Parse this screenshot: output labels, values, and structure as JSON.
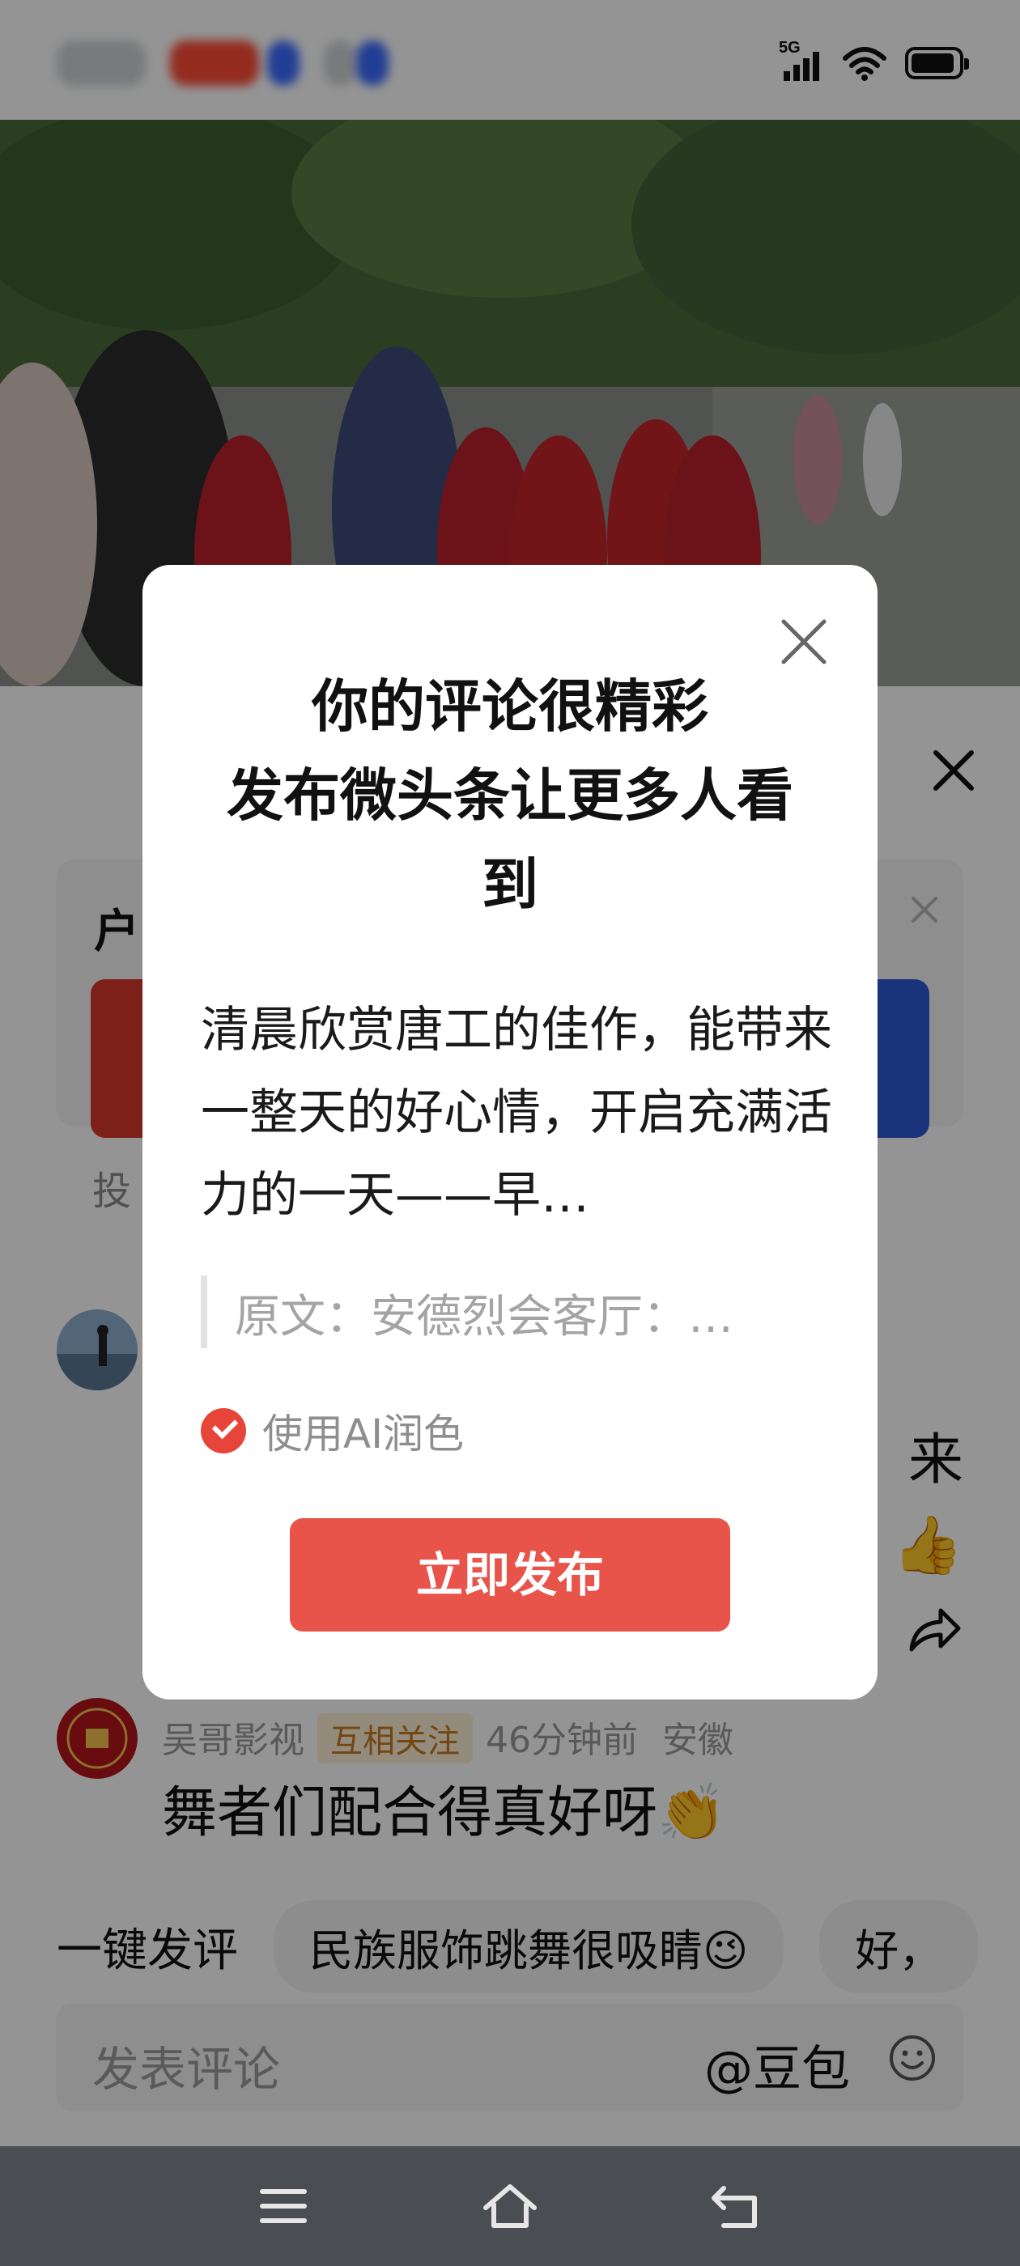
{
  "status_bar": {
    "network": "5G"
  },
  "dialog": {
    "title": "你的评论很精彩\n发布微头条让更多人看到",
    "body": "清晨欣赏唐工的佳作，能带来一整天的好心情，开启充满活力的一天——早…",
    "quote": "原文：安德烈会客厅：…",
    "ai_polish_label": "使用AI润色",
    "ai_polish_checked": true,
    "publish_label": "立即发布"
  },
  "banner": {
    "title": "户",
    "subtitle": "投"
  },
  "comments": [
    {
      "text_tail": "来",
      "emoji": "👍"
    },
    {
      "author": "吴哥影视",
      "tag": "互相关注",
      "time": "46分钟前",
      "location": "安徽",
      "text": "舞者们配合得真好呀👏"
    }
  ],
  "quick_comment": {
    "label": "一键发评",
    "chips": [
      "民族服饰跳舞很吸睛😉",
      "好，"
    ]
  },
  "input": {
    "placeholder": "发表评论",
    "mention": "@豆包"
  },
  "colors": {
    "accent_red": "#e8534a",
    "check_red": "#e8453a",
    "nav_bar": "#4a4d52"
  }
}
